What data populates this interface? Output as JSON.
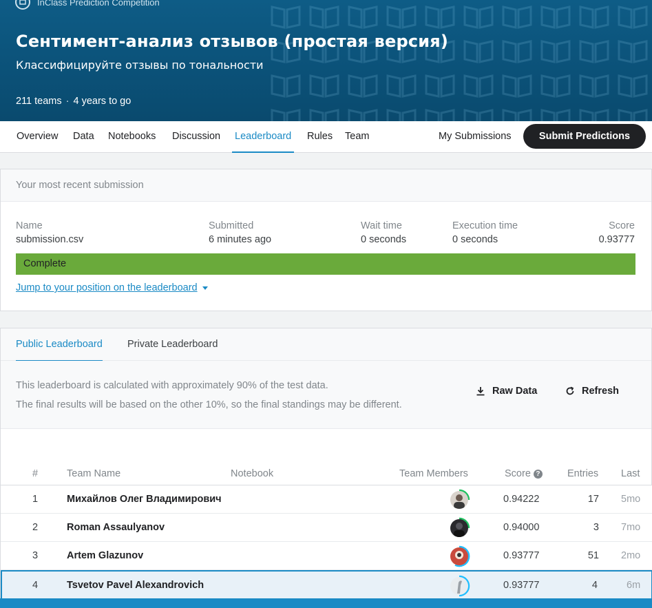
{
  "competition": {
    "type_label": "InClass Prediction Competition",
    "title": "Сентимент-анализ отзывов (простая версия)",
    "subtitle": "Классифицируйте отзывы по тональности",
    "teams": "211 teams",
    "separator": "·",
    "deadline": "4 years to go"
  },
  "nav": {
    "tabs": [
      {
        "label": "Overview"
      },
      {
        "label": "Data"
      },
      {
        "label": "Notebooks"
      },
      {
        "label": "Discussion"
      },
      {
        "label": "Leaderboard",
        "active": true
      },
      {
        "label": "Rules"
      },
      {
        "label": "Team"
      }
    ],
    "my_submissions": "My Submissions",
    "submit_button": "Submit Predictions"
  },
  "recent_submission": {
    "heading": "Your most recent submission",
    "columns": [
      {
        "label": "Name",
        "value": "submission.csv"
      },
      {
        "label": "Submitted",
        "value": "6 minutes ago"
      },
      {
        "label": "Wait time",
        "value": "0 seconds"
      },
      {
        "label": "Execution time",
        "value": "0 seconds"
      },
      {
        "label": "Score",
        "value": "0.93777"
      }
    ],
    "status": "Complete",
    "jump_link": "Jump to your position on the leaderboard"
  },
  "leaderboard": {
    "tabs": [
      {
        "label": "Public Leaderboard",
        "active": true
      },
      {
        "label": "Private Leaderboard"
      }
    ],
    "notice_line1": "This leaderboard is calculated with approximately 90% of the test data.",
    "notice_line2": "The final results will be based on the other 10%, so the final standings may be different.",
    "raw_data": "Raw Data",
    "refresh": "Refresh",
    "columns": {
      "rank": "#",
      "team_name": "Team Name",
      "notebook": "Notebook",
      "team_members": "Team Members",
      "score": "Score",
      "score_help": "?",
      "entries": "Entries",
      "last": "Last"
    },
    "rows": [
      {
        "rank": "1",
        "name": "Михайлов Олег Владимирович",
        "score": "0.94222",
        "entries": "17",
        "last": "5mo"
      },
      {
        "rank": "2",
        "name": "Roman Assaulyanov",
        "score": "0.94000",
        "entries": "3",
        "last": "7mo"
      },
      {
        "rank": "3",
        "name": "Artem Glazunov",
        "score": "0.93777",
        "entries": "51",
        "last": "2mo"
      },
      {
        "rank": "4",
        "name": "Tsvetov Pavel Alexandrovich",
        "score": "0.93777",
        "entries": "4",
        "last": "6m",
        "mine": true
      }
    ]
  },
  "colors": {
    "accent": "#1a8ac5",
    "banner": "#0b5178",
    "complete_green": "#6aaa3b",
    "tier_green": "#20beff"
  }
}
